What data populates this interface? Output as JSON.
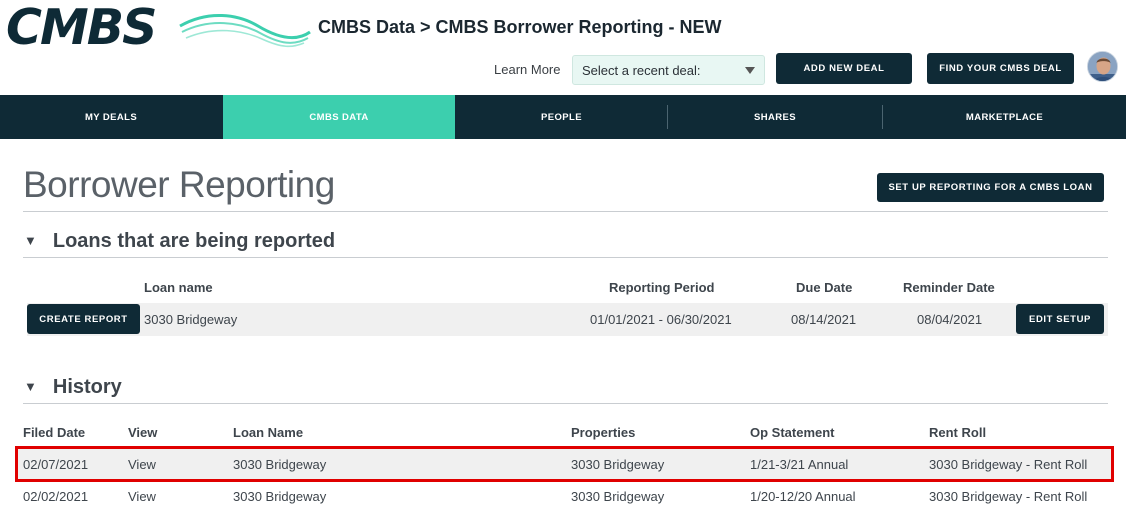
{
  "header": {
    "logo_text": "CMBS",
    "title": "CMBS Data > CMBS Borrower Reporting - NEW",
    "learn_more": "Learn More",
    "recent_deal_select": "Select a recent deal:",
    "add_deal_label": "ADD NEW DEAL",
    "find_deal_label": "FIND YOUR CMBS DEAL"
  },
  "nav": {
    "items": [
      {
        "label": "MY DEALS"
      },
      {
        "label": "CMBS DATA",
        "active": true
      },
      {
        "label": "PEOPLE"
      },
      {
        "label": "SHARES"
      },
      {
        "label": "MARKETPLACE"
      }
    ]
  },
  "page": {
    "title": "Borrower Reporting",
    "setup_button": "SET UP REPORTING FOR A CMBS LOAN"
  },
  "loans_section": {
    "title": "Loans that are being reported",
    "columns": {
      "loan_name": "Loan name",
      "reporting_period": "Reporting Period",
      "due_date": "Due Date",
      "reminder_date": "Reminder Date"
    },
    "rows": [
      {
        "create_label": "CREATE REPORT",
        "loan_name": "3030 Bridgeway",
        "reporting_period": "01/01/2021 - 06/30/2021",
        "due_date": "08/14/2021",
        "reminder_date": "08/04/2021",
        "edit_label": "EDIT SETUP"
      }
    ]
  },
  "history_section": {
    "title": "History",
    "columns": {
      "filed_date": "Filed Date",
      "view": "View",
      "loan_name": "Loan Name",
      "properties": "Properties",
      "op_statement": "Op Statement",
      "rent_roll": "Rent Roll"
    },
    "rows": [
      {
        "filed_date": "02/07/2021",
        "view": "View",
        "loan_name": "3030 Bridgeway",
        "properties": "3030 Bridgeway",
        "op_statement": "1/21-3/21 Annual",
        "rent_roll": "3030 Bridgeway - Rent Roll",
        "highlighted": true
      },
      {
        "filed_date": "02/02/2021",
        "view": "View",
        "loan_name": "3030 Bridgeway",
        "properties": "3030 Bridgeway",
        "op_statement": "1/20-12/20 Annual",
        "rent_roll": "3030 Bridgeway - Rent Roll",
        "highlighted": false
      }
    ]
  },
  "colors": {
    "navy": "#0f2a36",
    "teal": "#3ccfae",
    "highlight_outline": "#e00000"
  },
  "icons": [
    "logo-wave-icon",
    "chevron-down-icon",
    "collapse-triangle-icon",
    "avatar"
  ]
}
